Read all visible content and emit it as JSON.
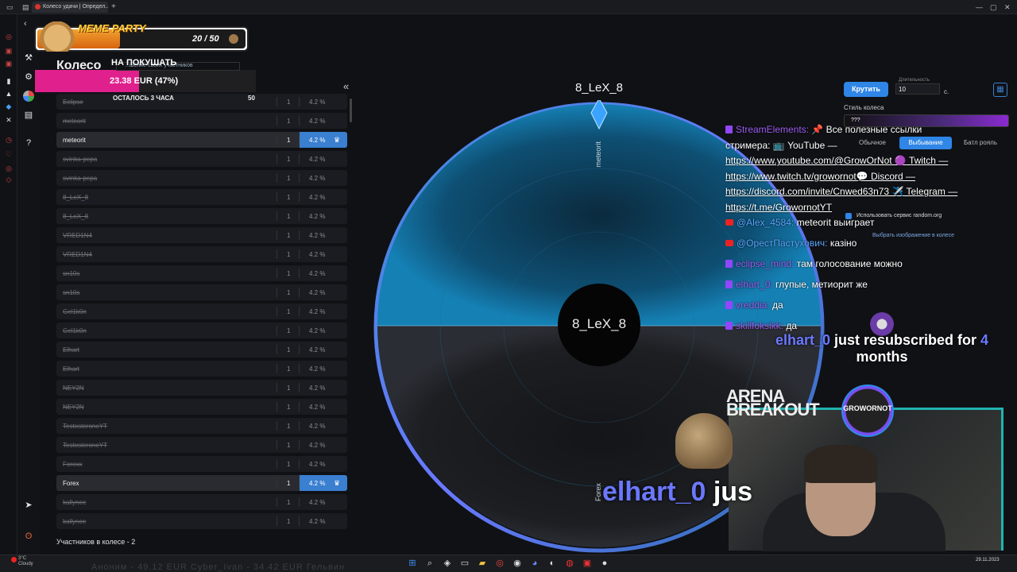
{
  "browser": {
    "tab_title": "Колесо удачи | Определ...",
    "new_tab": "+"
  },
  "page": {
    "title": "Колесо",
    "collapse": "«",
    "participants_label": "Участников в колесе - 2"
  },
  "participants": [
    {
      "name": "Eclipse",
      "count": "1",
      "percent": "4.2 %",
      "active": false
    },
    {
      "name": "meteorit",
      "count": "1",
      "percent": "4.2 %",
      "active": false
    },
    {
      "name": "meteorit",
      "count": "1",
      "percent": "4.2 %",
      "active": true
    },
    {
      "name": "svinka-pepa",
      "count": "1",
      "percent": "4.2 %",
      "active": false
    },
    {
      "name": "svinka-pepa",
      "count": "1",
      "percent": "4.2 %",
      "active": false
    },
    {
      "name": "8_LeX_8",
      "count": "1",
      "percent": "4.2 %",
      "active": false
    },
    {
      "name": "8_LeX_8",
      "count": "1",
      "percent": "4.2 %",
      "active": false
    },
    {
      "name": "VRED1N4",
      "count": "1",
      "percent": "4.2 %",
      "active": false
    },
    {
      "name": "VRED1N4",
      "count": "1",
      "percent": "4.2 %",
      "active": false
    },
    {
      "name": "sn10s",
      "count": "1",
      "percent": "4.2 %",
      "active": false
    },
    {
      "name": "sn10s",
      "count": "1",
      "percent": "4.2 %",
      "active": false
    },
    {
      "name": "Gel1k0n",
      "count": "1",
      "percent": "4.2 %",
      "active": false
    },
    {
      "name": "Gel1k0n",
      "count": "1",
      "percent": "4.2 %",
      "active": false
    },
    {
      "name": "Elhart",
      "count": "1",
      "percent": "4.2 %",
      "active": false
    },
    {
      "name": "Elhart",
      "count": "1",
      "percent": "4.2 %",
      "active": false
    },
    {
      "name": "NEY2N",
      "count": "1",
      "percent": "4.2 %",
      "active": false
    },
    {
      "name": "NEY2N",
      "count": "1",
      "percent": "4.2 %",
      "active": false
    },
    {
      "name": "TestosteroneYT",
      "count": "1",
      "percent": "4.2 %",
      "active": false
    },
    {
      "name": "TestosteroneYT",
      "count": "1",
      "percent": "4.2 %",
      "active": false
    },
    {
      "name": "Forexx",
      "count": "1",
      "percent": "4.2 %",
      "active": false
    },
    {
      "name": "Forex",
      "count": "1",
      "percent": "4.2 %",
      "active": true
    },
    {
      "name": "kallynee",
      "count": "1",
      "percent": "4.2 %",
      "active": false
    },
    {
      "name": "kallynee",
      "count": "1",
      "percent": "4.2 %",
      "active": false
    }
  ],
  "meme_party": {
    "title": "MEME PARTY",
    "count": "20 / 50"
  },
  "goal": {
    "heading": "НА ПОКУШАТЬ",
    "sub": "...шение своих участников",
    "amount": "23.38 EUR (47%)",
    "remaining": "ОСТАЛОСЬ 3 ЧАСА",
    "max": "50",
    "progress": 0.47
  },
  "wheel": {
    "winner_top": "8_LeX_8",
    "winner_center": "8_LeX_8",
    "label_top": "meteorit",
    "label_bottom": "Forex"
  },
  "controls": {
    "spin_label": "Крутить",
    "duration_label": "Длительность",
    "duration_value": "10",
    "duration_unit": "с.",
    "style_label": "Стиль колеса",
    "style_value": "???",
    "modes": [
      "Обычное",
      "Выбывание",
      "Батл рояль"
    ],
    "active_mode": "Выбывание",
    "use_random": "Использовать сервис random.org",
    "choose_image": "Выбрать изображение в колесе"
  },
  "chat": [
    {
      "platform": "twitch",
      "user": "StreamElements:",
      "text": " 📌 Все полезные ссылки"
    },
    {
      "platform": "none",
      "user": "",
      "text": "стримера: 📺 YouTube —"
    },
    {
      "platform": "none",
      "user": "",
      "text": "https://www.youtube.com/@GrowOrNot 🟣 Twitch —",
      "link": true
    },
    {
      "platform": "none",
      "user": "",
      "text": "https://www.twitch.tv/growornot💬 Discord —",
      "link": true
    },
    {
      "platform": "none",
      "user": "",
      "text": "https://discord.com/invite/Cnwed63n73 ✈️ Telegram —",
      "link": true
    },
    {
      "platform": "none",
      "user": "",
      "text": "https://t.me/GrowornotYT",
      "link": true
    },
    {
      "platform": "youtube",
      "user": "@Alex_4584:",
      "text": " meteorit выиграет"
    },
    {
      "platform": "youtube",
      "user": "@ОрестПастухович:",
      "text": " казіно"
    },
    {
      "platform": "twitch",
      "user": "eclipse_mind:",
      "text": " там голосование можно"
    },
    {
      "platform": "twitch",
      "user": "elhart_0:",
      "text": " глупые, метиорит же"
    },
    {
      "platform": "twitch",
      "user": "vreddia:",
      "text": " да"
    },
    {
      "platform": "twitch",
      "user": "skillfoksikk:",
      "text": " да"
    }
  ],
  "alert": {
    "user": "elhart_0",
    "text": " just resubscribed for ",
    "months": "4",
    "tail": "months"
  },
  "overlay": {
    "arena_line1": "ARENA",
    "arena_line2": "BREAKOUT",
    "logo_text": "GROWORNOT",
    "big_user": "elhart_0",
    "big_tail": " jus"
  },
  "taskbar": {
    "weather_temp": "3°C",
    "weather_desc": "Cloudy",
    "ticker": "Аноним - 49.12 EUR      Cyber_Ivan - 34.42 EUR      Гельвин",
    "date": "29.11.2023"
  }
}
